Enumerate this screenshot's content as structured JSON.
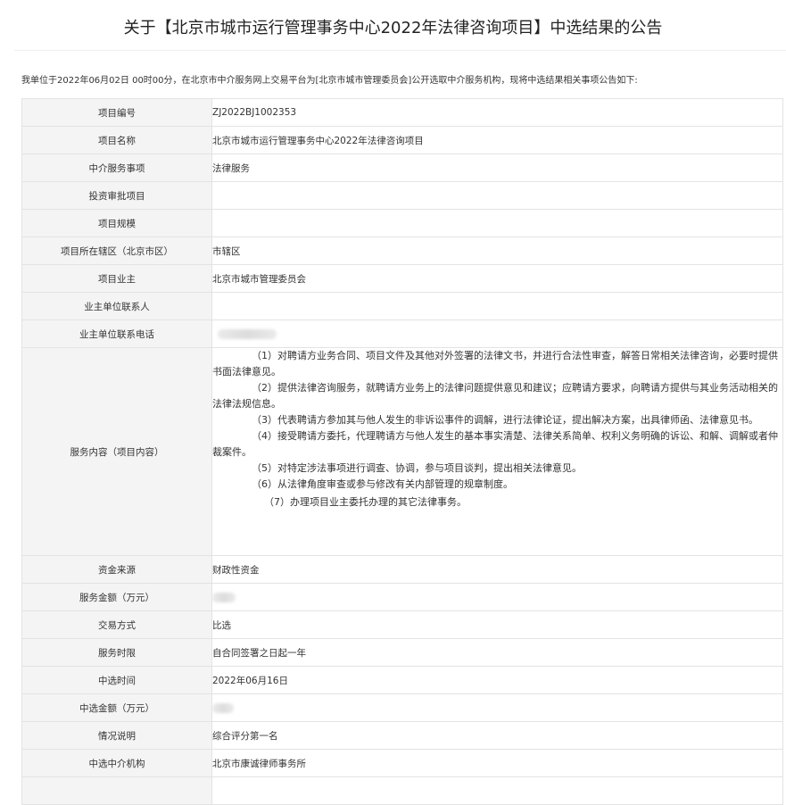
{
  "header": {
    "title": "关于【北京市城市运行管理事务中心2022年法律咨询项目】中选结果的公告"
  },
  "intro": "我单位于2022年06月02日 00时00分，在北京市中介服务网上交易平台为[北京市城市管理委员会]公开选取中介服务机构，现将中选结果相关事项公告如下:",
  "rows": [
    {
      "label": "项目编号",
      "value": "ZJ2022BJ1002353"
    },
    {
      "label": "项目名称",
      "value": "北京市城市运行管理事务中心2022年法律咨询项目"
    },
    {
      "label": "中介服务事项",
      "value": "法律服务"
    },
    {
      "label": "投资审批项目",
      "value": ""
    },
    {
      "label": "项目规模",
      "value": ""
    },
    {
      "label": "项目所在辖区（北京市区）",
      "value": "市辖区"
    },
    {
      "label": "项目业主",
      "value": "北京市城市管理委员会"
    },
    {
      "label": "业主单位联系人",
      "value": ""
    },
    {
      "label": "业主单位联系电话",
      "value": ""
    }
  ],
  "service": {
    "label": "服务内容（项目内容）",
    "items": [
      "（1）对聘请方业务合同、项目文件及其他对外签署的法律文书，并进行合法性审查，解答日常相关法律咨询，必要时提供书面法律意见。",
      "（2）提供法律咨询服务，就聘请方业务上的法律问题提供意见和建议；应聘请方要求，向聘请方提供与其业务活动相关的法律法规信息。",
      "（3）代表聘请方参加其与他人发生的非诉讼事件的调解，进行法律论证，提出解决方案，出具律师函、法律意见书。",
      "（4）接受聘请方委托，代理聘请方与他人发生的基本事实清楚、法律关系简单、权利义务明确的诉讼、和解、调解或者仲裁案件。",
      "（5）对特定涉法事项进行调查、协调，参与项目谈判，提出相关法律意见。",
      "（6）从法律角度审查或参与修改有关内部管理的规章制度。",
      "（7）办理项目业主委托办理的其它法律事务。"
    ]
  },
  "rows2": [
    {
      "label": "资金来源",
      "value": "财政性资金"
    },
    {
      "label": "服务金额（万元）",
      "value": ""
    },
    {
      "label": "交易方式",
      "value": "比选"
    },
    {
      "label": "服务时限",
      "value": "自合同签署之日起一年"
    },
    {
      "label": "中选时间",
      "value": "2022年06月16日"
    },
    {
      "label": "中选金额（万元）",
      "value": ""
    },
    {
      "label": "情况说明",
      "value": "综合评分第一名"
    },
    {
      "label": "中选中介机构",
      "value": "北京市康诚律师事务所"
    },
    {
      "label": "",
      "value": ""
    }
  ]
}
